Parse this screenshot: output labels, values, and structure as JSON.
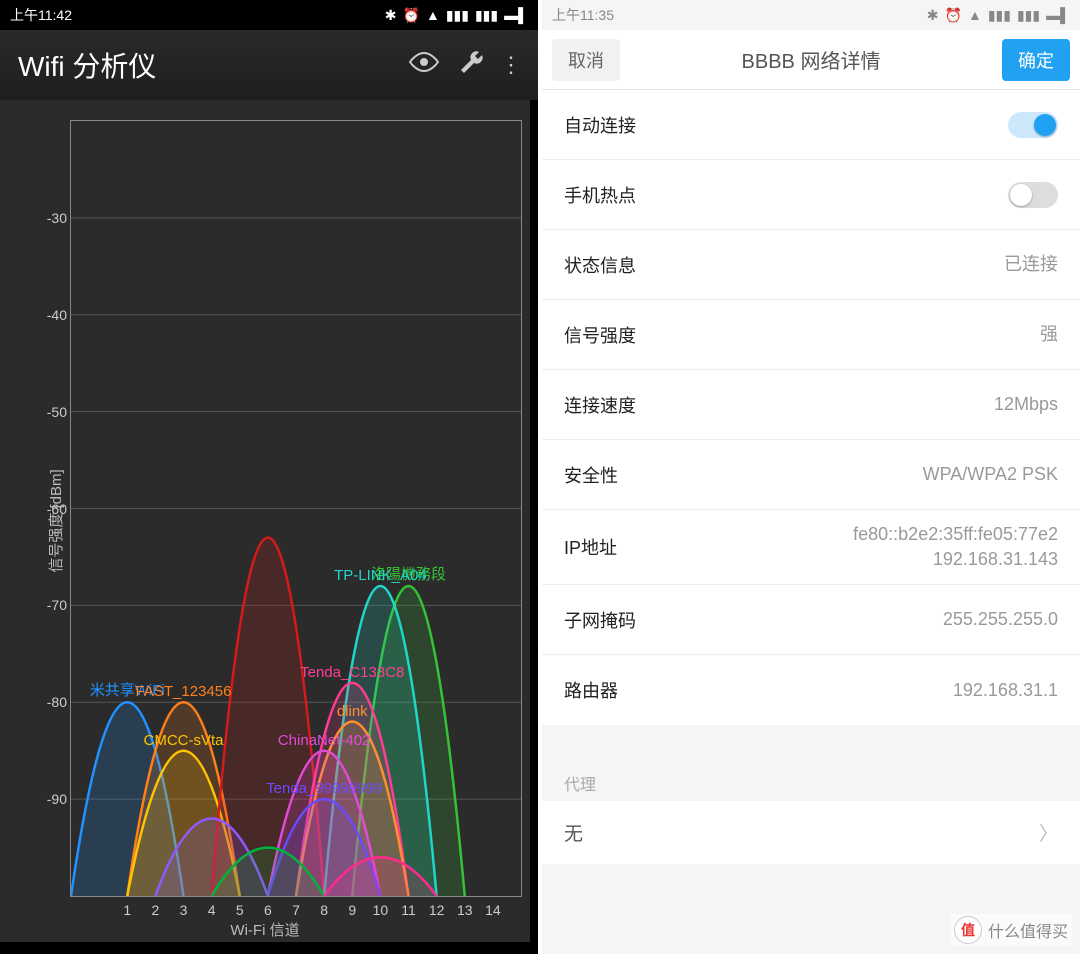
{
  "left": {
    "status": {
      "time": "上午11:42"
    },
    "app_title": "Wifi 分析仪",
    "ylabel": "信号强度 [dBm]",
    "xlabel": "Wi-Fi 信道"
  },
  "right": {
    "status": {
      "time": "上午11:35"
    },
    "nav": {
      "cancel": "取消",
      "ok": "确定",
      "title": "BBBB  网络详情"
    },
    "rows": {
      "auto_connect": "自动连接",
      "hotspot": "手机热点",
      "status_info": {
        "label": "状态信息",
        "value": "已连接"
      },
      "signal": {
        "label": "信号强度",
        "value": "强"
      },
      "speed": {
        "label": "连接速度",
        "value": "12Mbps"
      },
      "security": {
        "label": "安全性",
        "value": "WPA/WPA2 PSK"
      },
      "ip": {
        "label": "IP地址",
        "value": "fe80::b2e2:35ff:fe05:77e2\n192.168.31.143"
      },
      "mask": {
        "label": "子网掩码",
        "value": "255.255.255.0"
      },
      "router": {
        "label": "路由器",
        "value": "192.168.31.1"
      },
      "proxy_title": "代理",
      "proxy_value": "无"
    }
  },
  "watermark": {
    "badge": "值",
    "text": "什么值得买"
  },
  "chart_data": {
    "type": "line",
    "title": "",
    "xlabel": "Wi-Fi 信道",
    "ylabel": "信号强度 [dBm]",
    "ylim": [
      -100,
      -20
    ],
    "xticks": [
      1,
      2,
      3,
      4,
      5,
      6,
      7,
      8,
      9,
      10,
      11,
      12,
      13,
      14
    ],
    "yticks": [
      -30,
      -40,
      -50,
      -60,
      -70,
      -80,
      -90
    ],
    "networks": [
      {
        "ssid": "米共享WiFi",
        "channel_center": 1,
        "peak_dbm": -80,
        "color": "#2193ff"
      },
      {
        "ssid": "FAST_123456",
        "channel_center": 3,
        "peak_dbm": -80,
        "color": "#ff7f1a"
      },
      {
        "ssid": "CMCC-sVta",
        "channel_center": 3,
        "peak_dbm": -85,
        "color": "#ffc400"
      },
      {
        "ssid": "",
        "channel_center": 6,
        "peak_dbm": -63,
        "color": "#d41b1b"
      },
      {
        "ssid": "洛陽機務段",
        "channel_center": 11,
        "peak_dbm": -68,
        "color": "#36c236"
      },
      {
        "ssid": "TP-LINK_A04",
        "channel_center": 10,
        "peak_dbm": -68,
        "color": "#1fd6c9"
      },
      {
        "ssid": "Tenda_C133C8",
        "channel_center": 9,
        "peak_dbm": -78,
        "color": "#ff3e8f"
      },
      {
        "ssid": "dlink",
        "channel_center": 9,
        "peak_dbm": -82,
        "color": "#ff9030"
      },
      {
        "ssid": "ChinaNet-402",
        "channel_center": 8,
        "peak_dbm": -85,
        "color": "#e24bd8"
      },
      {
        "ssid": "Tenda_99999999",
        "channel_center": 8,
        "peak_dbm": -90,
        "color": "#6a4bff"
      },
      {
        "ssid": "",
        "channel_center": 4,
        "peak_dbm": -92,
        "color": "#8c5bff"
      },
      {
        "ssid": "",
        "channel_center": 6,
        "peak_dbm": -95,
        "color": "#00b33c"
      },
      {
        "ssid": "",
        "channel_center": 10,
        "peak_dbm": -96,
        "color": "#ff2a8d"
      }
    ]
  }
}
